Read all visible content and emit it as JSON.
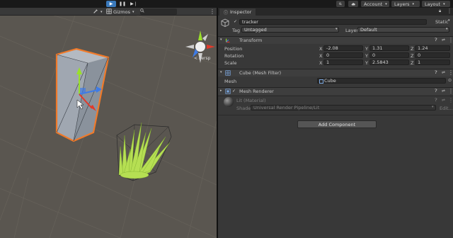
{
  "toolbar": {
    "play_icon": "▶",
    "pause_icon": "❚❚",
    "step_icon": "▶❘",
    "account_label": "Account",
    "layers_label": "Layers",
    "layout_label": "Layout"
  },
  "scene_toolbar": {
    "gizmos_label": "Gizmos"
  },
  "scene": {
    "persp_label": "< Persp"
  },
  "inspector": {
    "tab_label": "Inspector",
    "object_name": "tracker",
    "static_label": "Static",
    "tag_label": "Tag",
    "tag_value": "Untagged",
    "layer_label": "Layer",
    "layer_value": "Default",
    "transform": {
      "title": "Transform",
      "position_label": "Position",
      "rotation_label": "Rotation",
      "scale_label": "Scale",
      "position": {
        "x": "-2.08",
        "y": "1.31",
        "z": "1.24"
      },
      "rotation": {
        "x": "0",
        "y": "0",
        "z": "0"
      },
      "scale": {
        "x": "1",
        "y": "2.5843",
        "z": "1"
      }
    },
    "mesh_filter": {
      "title": "Cube (Mesh Filter)",
      "mesh_label": "Mesh",
      "mesh_value": "Cube"
    },
    "mesh_renderer": {
      "title": "Mesh Renderer"
    },
    "material": {
      "name": "Lit (Material)",
      "shader_label": "Shader",
      "shader_value": "Universal Render Pipeline/Lit",
      "edit_label": "Edit..."
    },
    "add_component_label": "Add Component"
  },
  "colors": {
    "accent": "#3a79bb",
    "selection_outline": "#f07a2a",
    "grass": "#a8d94a"
  }
}
